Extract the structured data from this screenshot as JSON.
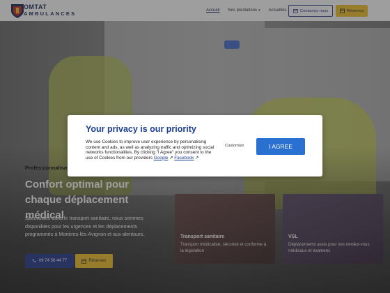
{
  "header": {
    "brand_line1": "OMTAT",
    "brand_line2": "AMBULANCES",
    "nav": [
      {
        "label": "Accueil"
      },
      {
        "label": "Nos prestations"
      },
      {
        "label": "Actualités"
      }
    ],
    "contact_label": "Contactez-nous",
    "reserve_label": "Réservez"
  },
  "hero": {
    "tagline": "Professionnalism",
    "title": "Confort optimal pour chaque déplacement médical",
    "description": "Spécialisés dans le transport sanitaire, nous sommes disponibles pour les urgences et les déplacements programmés à Morières-lès-Avignon et aux alentours.",
    "phone_label": "09 74 56 44 77",
    "reserve_label": "Réservez"
  },
  "services": [
    {
      "title": "Transport sanitaire",
      "description": "Transport médicalisé, sécurisé et conforme à la législation"
    },
    {
      "title": "VSL",
      "description": "Déplacements assis pour vos rendez-vous médicaux et examens"
    }
  ],
  "cookie": {
    "title": "Your privacy is our priority",
    "body_text": "We use Cookies to improve user experience by personalising content and ads, as well as analyzing traffic and optimizing social networks functionalities. By clicking \"I Agree\" you consent to the use of Cookies from our providers",
    "link_google": "Google",
    "link_facebook": "Facebook",
    "customize_label": "Customize",
    "agree_label": "I AGREE"
  },
  "colors": {
    "brand_navy": "#2a3c8c",
    "accent_yellow": "#f2c230",
    "cookie_title": "#1b3f93",
    "agree_button": "#2a70d0"
  }
}
